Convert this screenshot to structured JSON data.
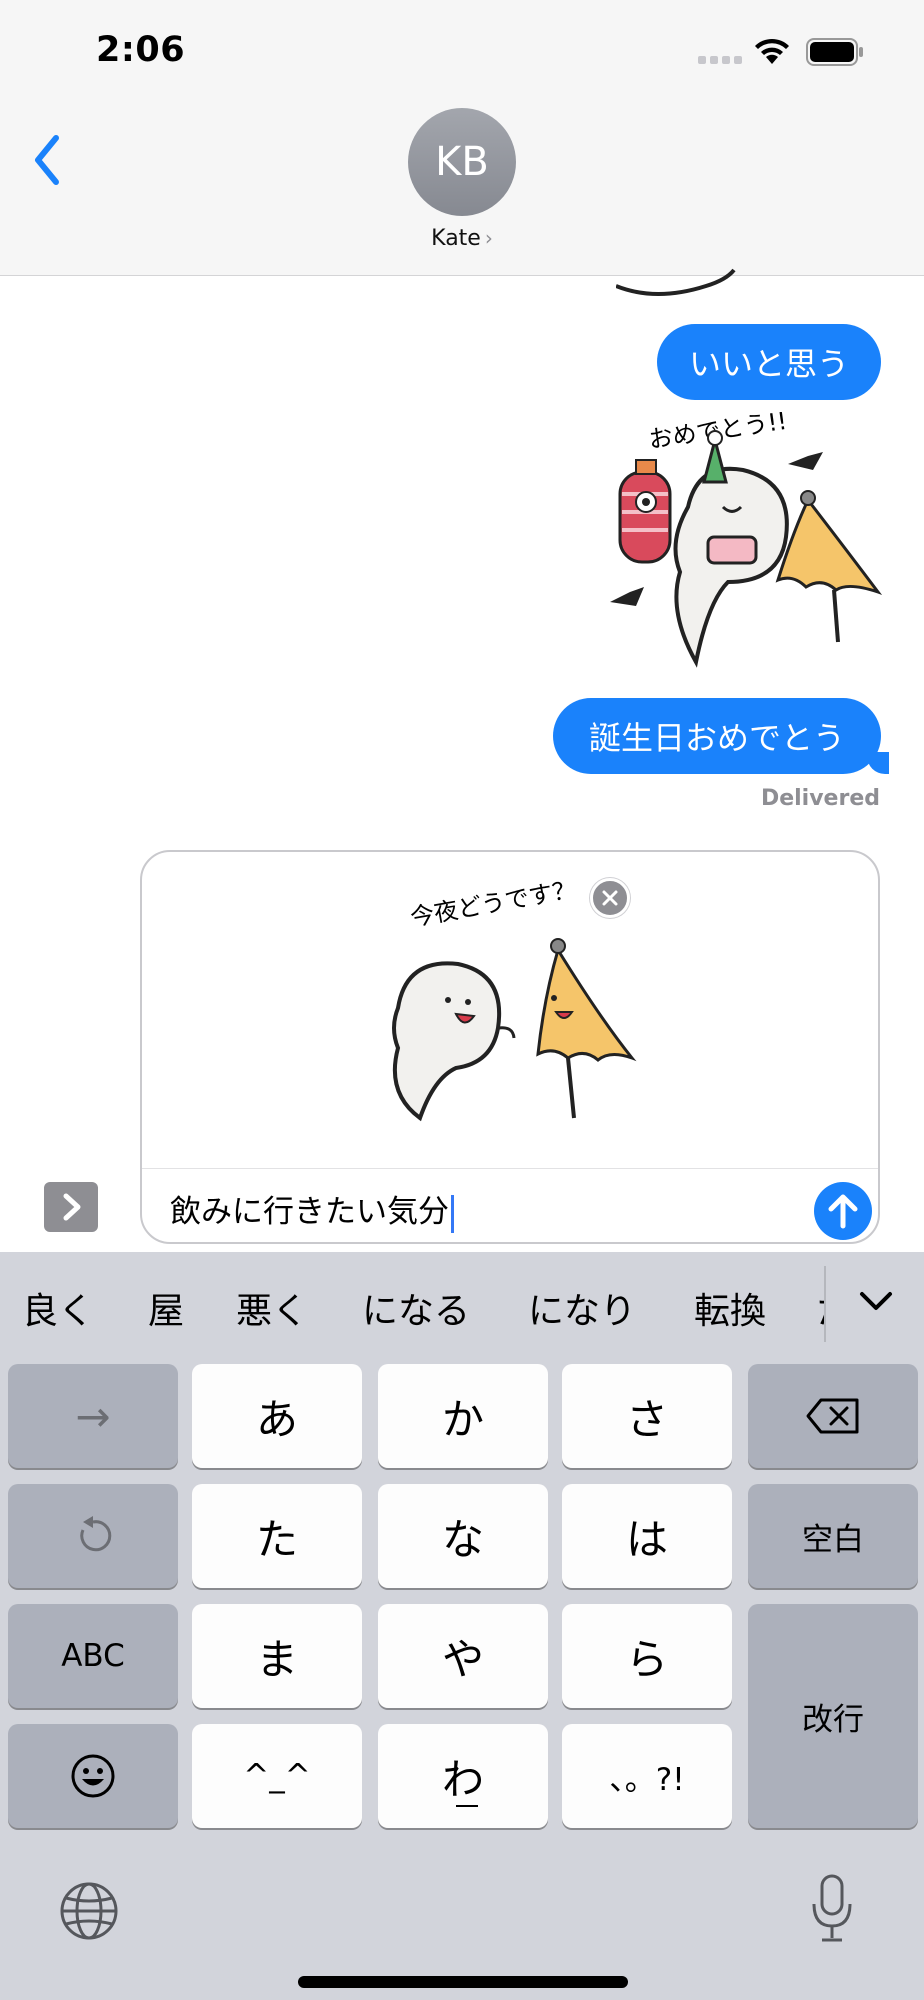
{
  "status_bar": {
    "time": "2:06"
  },
  "header": {
    "avatar_initials": "KB",
    "contact_name": "Kate",
    "contact_chevron": "›"
  },
  "messages": [
    {
      "text": "いいと思う"
    },
    {
      "text": "誕生日おめでとう"
    }
  ],
  "sticker_sent": {
    "caption": "おめでとう!!"
  },
  "delivered_label": "Delivered",
  "composer": {
    "sticker_caption": "今夜どうです？",
    "input_value": "飲みに行きたい気分"
  },
  "keyboard": {
    "suggestions": [
      "良く",
      "屋",
      "悪く",
      "になる",
      "になり",
      "転換",
      "た"
    ],
    "keys": {
      "arrow": "→",
      "a": "あ",
      "ka": "か",
      "sa": "さ",
      "ta": "た",
      "na": "な",
      "ha": "は",
      "space": "空白",
      "abc": "ABC",
      "ma": "ま",
      "ya": "や",
      "ra": "ら",
      "enter": "改行",
      "kaomoji": "^_^",
      "wa": "わ",
      "punct": "、。?!"
    }
  },
  "icons": [
    "back-chevron-icon",
    "wifi-icon",
    "battery-icon",
    "close-icon",
    "send-arrow-icon",
    "apps-chevron-icon",
    "delete-icon",
    "undo-icon",
    "emoji-icon",
    "globe-icon",
    "microphone-icon",
    "collapse-chevron-icon"
  ],
  "colors": {
    "accent": "#1a82fb",
    "keyboard_bg": "#d2d4db",
    "key_gray": "#acb0bb"
  }
}
